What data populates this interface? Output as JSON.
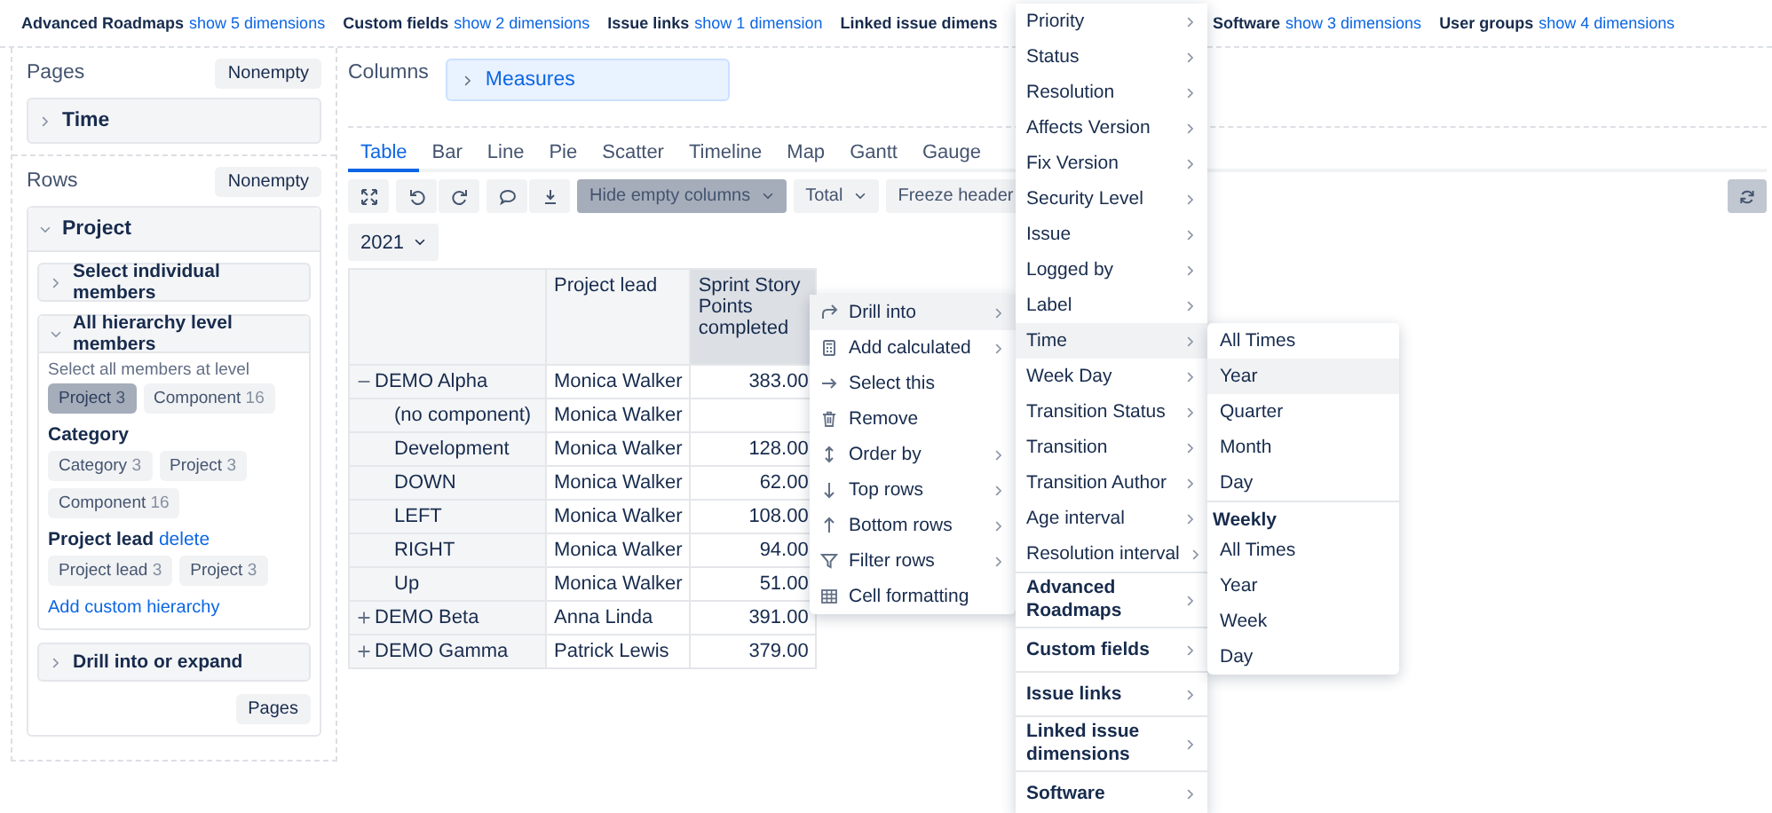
{
  "dimension_bar": [
    {
      "label": "Advanced Roadmaps",
      "link": "show 5 dimensions"
    },
    {
      "label": "Custom fields",
      "link": "show 2 dimensions"
    },
    {
      "label": "Issue links",
      "link": "show 1 dimension"
    },
    {
      "label": "Linked issue dimens"
    },
    {
      "label": "Software",
      "link": "show 3 dimensions"
    },
    {
      "label": "User groups",
      "link": "show 4 dimensions"
    }
  ],
  "pages": {
    "title": "Pages",
    "button": "Nonempty",
    "items": [
      {
        "label": "Time",
        "expanded": false
      }
    ]
  },
  "rows": {
    "title": "Rows",
    "button": "Nonempty",
    "dimension": {
      "label": "Project",
      "expanded": true,
      "sections": [
        {
          "label": "Select individual members",
          "expanded": false
        },
        {
          "label": "All hierarchy level members",
          "expanded": true,
          "hint": "Select all members at level",
          "levels": [
            {
              "label": "Project",
              "count": "3",
              "selected": true
            },
            {
              "label": "Component",
              "count": "16",
              "selected": false
            }
          ],
          "hierarchies": [
            {
              "title": "Category",
              "chips": [
                {
                  "label": "Category",
                  "count": "3"
                },
                {
                  "label": "Project",
                  "count": "3"
                },
                {
                  "label": "Component",
                  "count": "16"
                }
              ]
            },
            {
              "title": "Project lead",
              "action": "delete",
              "chips": [
                {
                  "label": "Project lead",
                  "count": "3"
                },
                {
                  "label": "Project",
                  "count": "3"
                }
              ]
            }
          ],
          "link": "Add custom hierarchy"
        },
        {
          "label": "Drill into or expand",
          "expanded": false
        }
      ],
      "button": "Pages"
    }
  },
  "columns": {
    "title": "Columns",
    "items": [
      {
        "label": "Measures",
        "expanded": false
      }
    ]
  },
  "view_tabs": [
    {
      "label": "Table",
      "selected": true
    },
    {
      "label": "Bar",
      "selected": false
    },
    {
      "label": "Line",
      "selected": false
    },
    {
      "label": "Pie",
      "selected": false
    },
    {
      "label": "Scatter",
      "selected": false
    },
    {
      "label": "Timeline",
      "selected": false
    },
    {
      "label": "Map",
      "selected": false
    },
    {
      "label": "Gantt",
      "selected": false
    },
    {
      "label": "Gauge",
      "selected": false
    }
  ],
  "toolbar": [
    {
      "kind": "dropdown",
      "label": "Hide empty columns",
      "selected": true
    },
    {
      "kind": "dropdown",
      "label": "Total",
      "selected": false
    },
    {
      "kind": "button",
      "label": "Freeze header"
    }
  ],
  "page_filter": "2021",
  "table": {
    "columns": [
      {
        "label": "Project lead",
        "selected": false
      },
      {
        "label": "Sprint Story Points completed",
        "selected": true
      }
    ],
    "rows": [
      {
        "label": "DEMO Alpha",
        "expanded": true,
        "lead": "Monica Walker",
        "value": "383.00",
        "children": [
          {
            "label": "(no component)",
            "lead": "Monica Walker"
          },
          {
            "label": "Development",
            "lead": "Monica Walker",
            "value": "128.00"
          },
          {
            "label": "DOWN",
            "lead": "Monica Walker",
            "value": "62.00"
          },
          {
            "label": "LEFT",
            "lead": "Monica Walker",
            "value": "108.00"
          },
          {
            "label": "RIGHT",
            "lead": "Monica Walker",
            "value": "94.00"
          },
          {
            "label": "Up",
            "lead": "Monica Walker",
            "value": "51.00"
          }
        ]
      },
      {
        "label": "DEMO Beta",
        "expanded": false,
        "lead": "Anna Linda",
        "value": "391.00"
      },
      {
        "label": "DEMO Gamma",
        "expanded": false,
        "lead": "Patrick Lewis",
        "value": "379.00"
      }
    ]
  },
  "context_menu": [
    {
      "kind": "drill",
      "label": "Drill into",
      "submenu": true,
      "selected": true
    },
    {
      "kind": "calculator",
      "label": "Add calculated",
      "submenu": true,
      "selected": false
    },
    {
      "kind": "arrow-right",
      "label": "Select this",
      "submenu": false,
      "selected": false
    },
    {
      "kind": "trash",
      "label": "Remove",
      "submenu": false,
      "selected": false
    },
    {
      "kind": "sort",
      "label": "Order by",
      "submenu": true,
      "selected": false
    },
    {
      "kind": "arrow-down",
      "label": "Top rows",
      "submenu": true,
      "selected": false
    },
    {
      "kind": "arrow-up",
      "label": "Bottom rows",
      "submenu": true,
      "selected": false
    },
    {
      "kind": "filter",
      "label": "Filter rows",
      "submenu": true,
      "selected": false
    },
    {
      "kind": "grid",
      "label": "Cell formatting",
      "submenu": false,
      "selected": false
    }
  ],
  "dimension_menu": [
    {
      "kind": "dimension",
      "label": "Priority",
      "selected": false
    },
    {
      "kind": "dimension",
      "label": "Status",
      "selected": false
    },
    {
      "kind": "dimension",
      "label": "Resolution",
      "selected": false
    },
    {
      "kind": "dimension",
      "label": "Affects Version",
      "selected": false
    },
    {
      "kind": "dimension",
      "label": "Fix Version",
      "selected": false
    },
    {
      "kind": "dimension",
      "label": "Security Level",
      "selected": false
    },
    {
      "kind": "dimension",
      "label": "Issue",
      "selected": false
    },
    {
      "kind": "dimension",
      "label": "Logged by",
      "selected": false
    },
    {
      "kind": "dimension",
      "label": "Label",
      "selected": false
    },
    {
      "kind": "dimension",
      "label": "Time",
      "selected": true
    },
    {
      "kind": "dimension",
      "label": "Week Day",
      "selected": false
    },
    {
      "kind": "dimension",
      "label": "Transition Status",
      "selected": false
    },
    {
      "kind": "dimension",
      "label": "Transition",
      "selected": false
    },
    {
      "kind": "dimension",
      "label": "Transition Author",
      "selected": false
    },
    {
      "kind": "dimension",
      "label": "Age interval",
      "selected": false
    },
    {
      "kind": "dimension",
      "label": "Resolution interval",
      "selected": false
    },
    {
      "kind": "group",
      "label": "Advanced Roadmaps",
      "selected": false
    },
    {
      "kind": "group",
      "label": "Custom fields",
      "selected": false
    },
    {
      "kind": "group",
      "label": "Issue links",
      "selected": false
    },
    {
      "kind": "group",
      "label": "Linked issue dimensions",
      "selected": false
    },
    {
      "kind": "group",
      "label": "Software",
      "selected": false
    }
  ],
  "time_submenu": [
    {
      "items": [
        {
          "label": "All Times",
          "selected": false
        },
        {
          "label": "Year",
          "selected": true
        },
        {
          "label": "Quarter",
          "selected": false
        },
        {
          "label": "Month",
          "selected": false
        },
        {
          "label": "Day",
          "selected": false
        }
      ]
    },
    {
      "heading": "Weekly",
      "items": [
        {
          "label": "All Times",
          "selected": false
        },
        {
          "label": "Year",
          "selected": false
        },
        {
          "label": "Week",
          "selected": false
        },
        {
          "label": "Day",
          "selected": false
        }
      ]
    }
  ]
}
